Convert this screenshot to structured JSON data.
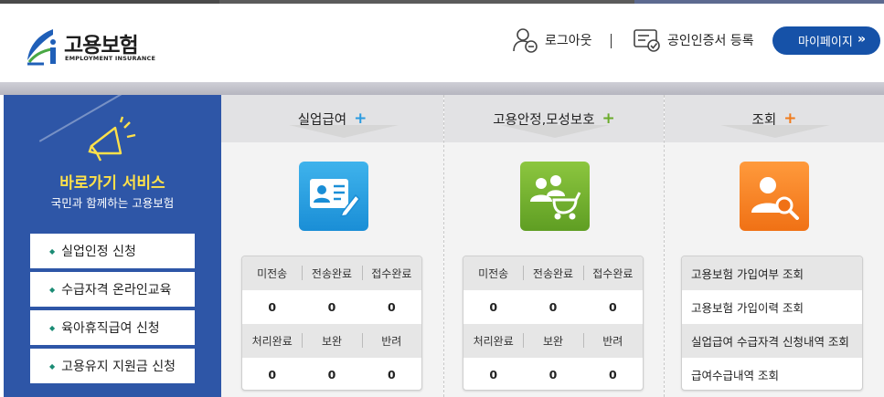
{
  "header": {
    "logo_text": "고용보험",
    "logo_sub": "EMPLOYMENT INSURANCE",
    "logout_label": "로그아웃",
    "cert_label": "공인인증서 등록",
    "mypage_label": "마이페이지",
    "mypage_chevron": "»"
  },
  "left_panel": {
    "title": "바로가기 서비스",
    "subtitle": "국민과 함께하는 고용보험",
    "items": [
      {
        "label": "실업인정 신청"
      },
      {
        "label": "수급자격 온라인교육"
      },
      {
        "label": "육아휴직급여 신청"
      },
      {
        "label": "고용유지 지원금 신청"
      }
    ]
  },
  "columns": [
    {
      "title": "실업급여",
      "plus": "+",
      "accent": "#2a9be0",
      "stats": {
        "row1_labels": [
          "미전송",
          "전송완료",
          "접수완료"
        ],
        "row1_values": [
          "0",
          "0",
          "0"
        ],
        "row2_labels": [
          "처리완료",
          "보완",
          "반려"
        ],
        "row2_values": [
          "0",
          "0",
          "0"
        ]
      }
    },
    {
      "title": "고용안정,모성보호",
      "plus": "+",
      "accent": "#6aab2a",
      "stats": {
        "row1_labels": [
          "미전송",
          "전송완료",
          "접수완료"
        ],
        "row1_values": [
          "0",
          "0",
          "0"
        ],
        "row2_labels": [
          "처리완료",
          "보완",
          "반려"
        ],
        "row2_values": [
          "0",
          "0",
          "0"
        ]
      }
    },
    {
      "title": "조회",
      "plus": "+",
      "accent": "#f07b1c",
      "links": [
        {
          "label": "고용보험 가입여부 조회"
        },
        {
          "label": "고용보험 가입이력 조회"
        },
        {
          "label": "실업급여 수급자격 신청내역 조회"
        },
        {
          "label": "급여수급내역 조회"
        }
      ]
    }
  ],
  "colors": {
    "primary": "#1652a8",
    "panel_blue": "#2e56a7",
    "quick_bullet": "#1a8b74",
    "panel_title": "#ffe14a"
  }
}
